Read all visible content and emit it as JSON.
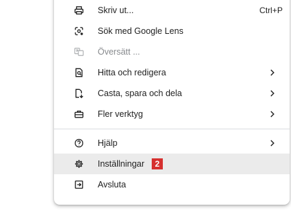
{
  "menu": {
    "items": [
      {
        "label": "Skriv ut...",
        "shortcut": "Ctrl+P",
        "icon": "printer-icon"
      },
      {
        "label": "Sök med Google Lens",
        "icon": "google-lens-icon"
      },
      {
        "label": "Översätt ...",
        "icon": "translate-icon",
        "disabled": true
      },
      {
        "label": "Hitta och redigera",
        "icon": "find-edit-icon",
        "submenu": true
      },
      {
        "label": "Casta, spara och dela",
        "icon": "cast-save-share-icon",
        "submenu": true
      },
      {
        "label": "Fler verktyg",
        "icon": "toolbox-icon",
        "submenu": true
      },
      {
        "label": "Hjälp",
        "icon": "help-icon",
        "submenu": true
      },
      {
        "label": "Inställningar",
        "icon": "settings-gear-icon",
        "highlighted": true
      },
      {
        "label": "Avsluta",
        "icon": "exit-icon"
      }
    ],
    "annotation_badge": "2"
  },
  "colors": {
    "highlight": "#ebebeb",
    "badge": "#d6302f",
    "divider": "#dadce0"
  }
}
